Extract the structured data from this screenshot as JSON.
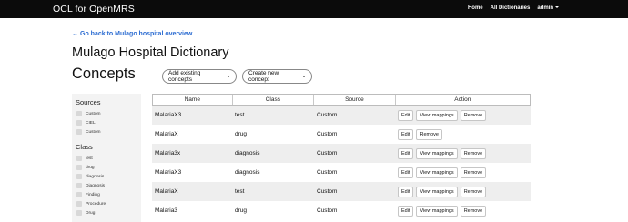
{
  "nav": {
    "brand": "OCL for OpenMRS",
    "links": [
      "Home",
      "All Dictionaries"
    ],
    "user": "admin"
  },
  "back_link": "Go back to Mulago hospital overview",
  "dictionary_title": "Mulago Hospital Dictionary",
  "concepts_title": "Concepts",
  "buttons": {
    "add_existing": "Add existing concepts",
    "create_new": "Create new concept"
  },
  "sidebar": {
    "sources_heading": "Sources",
    "sources": [
      "Custom",
      "CIEL",
      "Custom"
    ],
    "class_heading": "Class",
    "classes": [
      "test",
      "drug",
      "diagnosis",
      "Diagnosis",
      "Finding",
      "Procedure",
      "Drug"
    ]
  },
  "table": {
    "headers": [
      "Name",
      "Class",
      "Source",
      "Action"
    ],
    "rows": [
      {
        "name": "MalariaX3",
        "class": "test",
        "source": "Custom",
        "actions": [
          "Edit",
          "View mappings",
          "Remove"
        ]
      },
      {
        "name": "MalariaX",
        "class": "drug",
        "source": "Custom",
        "actions": [
          "Edit",
          "Remove"
        ]
      },
      {
        "name": "Malaria3x",
        "class": "diagnosis",
        "source": "Custom",
        "actions": [
          "Edit",
          "View mappings",
          "Remove"
        ]
      },
      {
        "name": "MalariaX3",
        "class": "diagnosis",
        "source": "Custom",
        "actions": [
          "Edit",
          "View mappings",
          "Remove"
        ]
      },
      {
        "name": "MalariaX",
        "class": "test",
        "source": "Custom",
        "actions": [
          "Edit",
          "View mappings",
          "Remove"
        ]
      },
      {
        "name": "Malaria3",
        "class": "drug",
        "source": "Custom",
        "actions": [
          "Edit",
          "View mappings",
          "Remove"
        ]
      }
    ]
  },
  "colors": {
    "navbar": "#0b0b0b",
    "link": "#2a6bd1",
    "row_stripe": "#eeeeee"
  }
}
